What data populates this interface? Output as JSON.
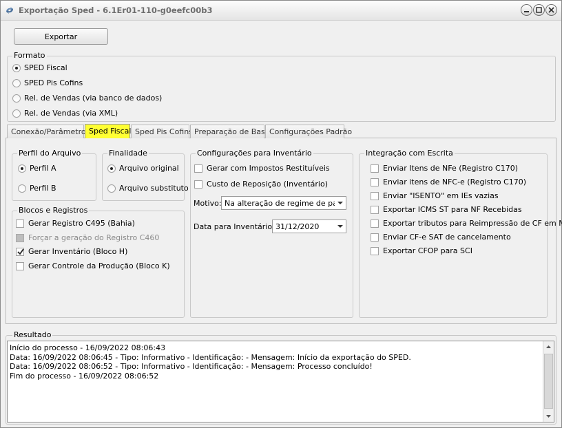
{
  "window": {
    "title": "Exportação Sped - 6.1Er01-110-g0eefc00b3"
  },
  "toolbar": {
    "export_label": "Exportar"
  },
  "formato": {
    "legend": "Formato",
    "options": [
      {
        "label": "SPED Fiscal",
        "selected": true
      },
      {
        "label": "SPED Pis Cofins",
        "selected": false
      },
      {
        "label": "Rel. de Vendas (via banco de dados)",
        "selected": false
      },
      {
        "label": "Rel. de Vendas (via XML)",
        "selected": false
      }
    ]
  },
  "tabs": [
    {
      "label": "Conexão/Parâmetros",
      "active": false
    },
    {
      "label": "Sped Fiscal",
      "active": true
    },
    {
      "label": "Sped Pis Cofins",
      "active": false
    },
    {
      "label": "Preparação de Base",
      "active": false
    },
    {
      "label": "Configurações Padrão",
      "active": false
    }
  ],
  "perfil": {
    "legend": "Perfil do Arquivo",
    "options": [
      {
        "label": "Perfil A",
        "selected": true
      },
      {
        "label": "Perfil B",
        "selected": false
      }
    ]
  },
  "finalidade": {
    "legend": "Finalidade",
    "options": [
      {
        "label": "Arquivo original",
        "selected": true
      },
      {
        "label": "Arquivo substituto",
        "selected": false
      }
    ]
  },
  "blocos": {
    "legend": "Blocos e Registros",
    "items": [
      {
        "label": "Gerar Registro C495 (Bahia)",
        "checked": false,
        "disabled": false
      },
      {
        "label": "Forçar a geração do Registro C460",
        "checked": false,
        "disabled": true
      },
      {
        "label": "Gerar Inventário (Bloco H)",
        "checked": true,
        "disabled": false
      },
      {
        "label": "Gerar Controle da Produção (Bloco K)",
        "checked": false,
        "disabled": false
      }
    ]
  },
  "inventario": {
    "legend": "Configurações para Inventário",
    "items": [
      {
        "label": "Gerar com Impostos Restituíveis",
        "checked": false
      },
      {
        "label": "Custo de Reposição (Inventário)",
        "checked": false
      }
    ],
    "motivo_label": "Motivo:",
    "motivo_value": "Na alteração de regime de pagam",
    "data_label": "Data para Inventário:",
    "data_value": "31/12/2020"
  },
  "integracao": {
    "legend": "Integração com Escrita",
    "items": [
      {
        "label": "Enviar Itens de NFe (Registro C170)",
        "checked": false
      },
      {
        "label": "Enviar itens de NFC-e (Registro C170)",
        "checked": false
      },
      {
        "label": "Enviar \"ISENTO\" em IEs vazias",
        "checked": false
      },
      {
        "label": "Exportar ICMS ST para NF Recebidas",
        "checked": false
      },
      {
        "label": "Exportar tributos para Reimpressão de CF em NF",
        "checked": false
      },
      {
        "label": "Enviar CF-e SAT de cancelamento",
        "checked": false
      },
      {
        "label": "Exportar CFOP para SCI",
        "checked": false
      }
    ]
  },
  "resultado": {
    "legend": "Resultado",
    "lines": [
      "Início do processo - 16/09/2022 08:06:43",
      "Data: 16/09/2022 08:06:45 - Tipo: Informativo - Identificação:  - Mensagem: Início da exportação do SPED.",
      "Data: 16/09/2022 08:06:52 - Tipo: Informativo - Identificação:  - Mensagem: Processo concluído!",
      "Fim do processo - 16/09/2022 08:06:52"
    ]
  }
}
